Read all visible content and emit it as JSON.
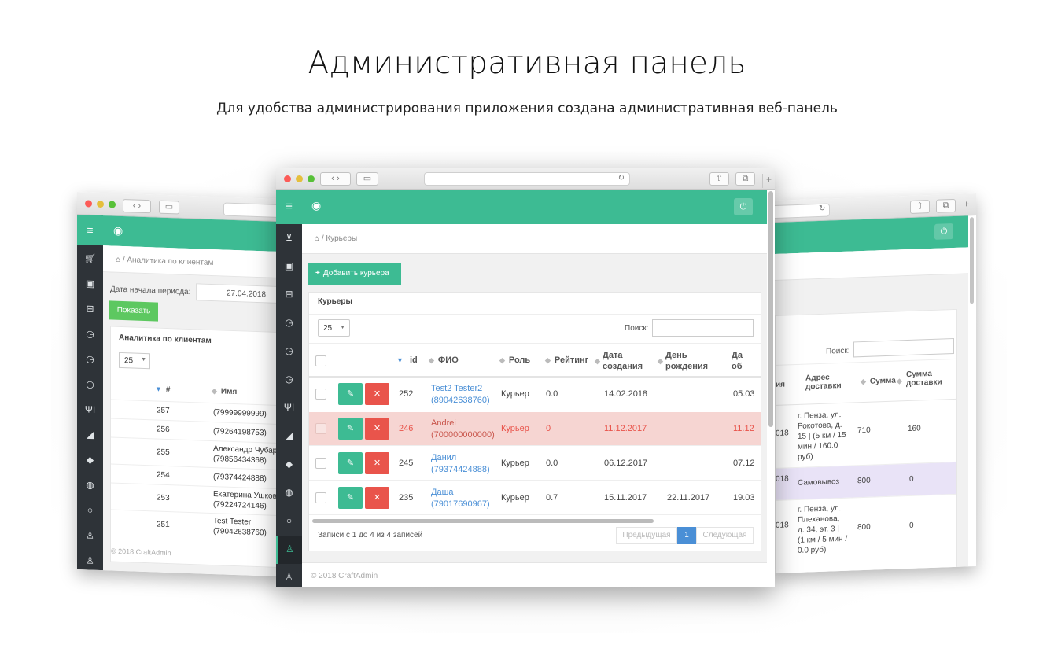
{
  "page": {
    "title": "Административная панель",
    "subtitle": "Для удобства администрирования приложения создана административная веб-панель"
  },
  "colors": {
    "accent": "#3dbb93",
    "sidebar": "#2e3338",
    "danger": "#e9544b",
    "highlight_row": "#f6d5d2",
    "purple_row": "#e9e3f7",
    "link": "#4a8fd6"
  },
  "left_window": {
    "breadcrumb": "Аналитика по клиентам",
    "period_label": "Дата начала периода:",
    "period_value": "27.04.2018",
    "show_button": "Показать",
    "panel_title": "Аналитика по клиентам",
    "page_size": "25",
    "columns": [
      "#",
      "Имя"
    ],
    "rows": [
      {
        "id": "257",
        "name": "(79999999999)"
      },
      {
        "id": "256",
        "name": "(79264198753)"
      },
      {
        "id": "255",
        "name": "Александр Чубар",
        "phone": "(79856434368)"
      },
      {
        "id": "254",
        "name": "(79374424888)"
      },
      {
        "id": "253",
        "name": "Екатерина Ушков",
        "phone": "(79224724146)"
      },
      {
        "id": "251",
        "name": "Test Tester",
        "phone": "(79042638760)"
      }
    ],
    "footer": "© 2018 CraftAdmin"
  },
  "center_window": {
    "breadcrumb": "Курьеры",
    "add_button": "Добавить курьера",
    "panel_title": "Курьеры",
    "page_size": "25",
    "search_label": "Поиск:",
    "columns": [
      "id",
      "ФИО",
      "Роль",
      "Рейтинг",
      "Дата создания",
      "День рождения",
      "Да об"
    ],
    "rows": [
      {
        "id": "252",
        "name": "Test2 Tester2",
        "phone": "(89042638760)",
        "role": "Курьер",
        "rating": "0.0",
        "created": "14.02.2018",
        "birthday": "",
        "last": "05.03"
      },
      {
        "id": "246",
        "name": "Andrei",
        "phone": "(700000000000)",
        "role": "Курьер",
        "rating": "0",
        "created": "11.12.2017",
        "birthday": "",
        "last": "11.12"
      },
      {
        "id": "245",
        "name": "Данил",
        "phone": "(79374424888)",
        "role": "Курьер",
        "rating": "0.0",
        "created": "06.12.2017",
        "birthday": "",
        "last": "07.12"
      },
      {
        "id": "235",
        "name": "Даша",
        "phone": "(79017690967)",
        "role": "Курьер",
        "rating": "0.7",
        "created": "15.11.2017",
        "birthday": "22.11.2017",
        "last": "19.03"
      }
    ],
    "records_info": "Записи с 1 до 4 из 4 записей",
    "prev": "Предыдущая",
    "page": "1",
    "next": "Следующая",
    "footer": "© 2018 CraftAdmin",
    "edit_icon": "pencil-icon",
    "delete_icon": "x-icon"
  },
  "right_window": {
    "search_label": "Поиск:",
    "columns": [
      "ия",
      "Адрес доставки",
      "Сумма",
      "Сумма доставки"
    ],
    "rows": [
      {
        "date": "018",
        "address": "г. Пенза, ул. Рокотова, д. 15 | (5 км / 15 мин / 160.0 руб)",
        "sum": "710",
        "delivery": "160"
      },
      {
        "date": "018",
        "address": "Самовывоз",
        "sum": "800",
        "delivery": "0"
      },
      {
        "date": "018",
        "address": "г. Пенза, ул. Плеханова, д. 34, эт. 3 | (1 км / 5 мин / 0.0 руб)",
        "sum": "800",
        "delivery": "0"
      }
    ]
  }
}
